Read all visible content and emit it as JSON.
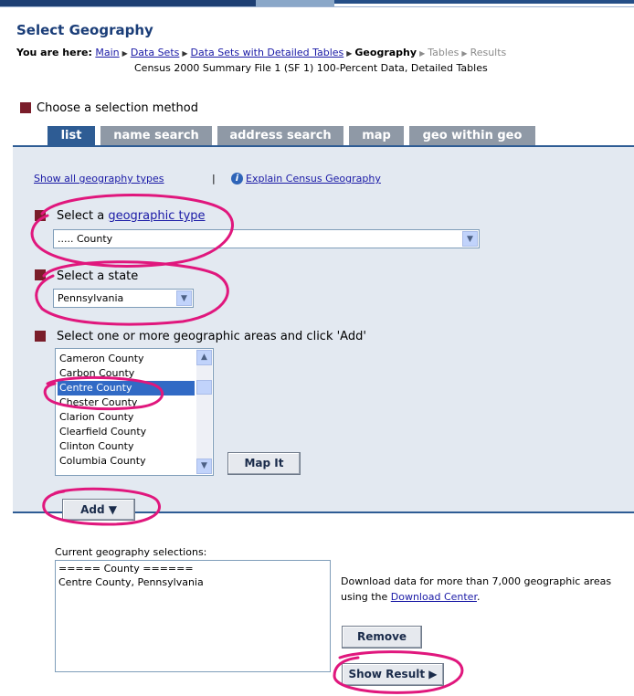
{
  "page": {
    "title": "Select Geography"
  },
  "breadcrumb": {
    "you_are_here": "You are here:",
    "items": [
      "Main",
      "Data Sets",
      "Data Sets with Detailed Tables"
    ],
    "current": "Geography",
    "upcoming": [
      "Tables",
      "Results"
    ]
  },
  "dataset_name": "Census 2000 Summary File 1 (SF 1) 100-Percent Data, Detailed Tables",
  "method": {
    "heading": "Choose a selection method",
    "tabs": [
      "list",
      "name search",
      "address search",
      "map",
      "geo within geo"
    ],
    "active_tab": "list"
  },
  "links": {
    "show_all": "Show all geography types",
    "separator": "|",
    "explain": "Explain Census Geography",
    "info_icon": "i"
  },
  "geo_type": {
    "label_prefix": "Select a ",
    "label_link": "geographic type",
    "value": "..... County"
  },
  "state": {
    "label": "Select a state",
    "value": "Pennsylvania"
  },
  "areas": {
    "label": "Select one or more geographic areas and click 'Add'",
    "items": [
      "Cameron County",
      "Carbon County",
      "Centre County",
      "Chester County",
      "Clarion County",
      "Clearfield County",
      "Clinton County",
      "Columbia County"
    ],
    "selected": "Centre County",
    "map_it": "Map It"
  },
  "add_button": "Add ▼",
  "current": {
    "label": "Current geography selections:",
    "lines": [
      "===== County ======",
      "Centre County, Pennsylvania"
    ]
  },
  "download": {
    "text": "Download data for more than 7,000 geographic areas using the ",
    "link": "Download Center",
    "period": "."
  },
  "remove_button": "Remove",
  "show_result_button": "Show Result ▶",
  "colors": {
    "accent": "#2e5c94",
    "bullet": "#7a1d2a",
    "annotation": "#e0177d",
    "selected_row": "#316ac5"
  }
}
